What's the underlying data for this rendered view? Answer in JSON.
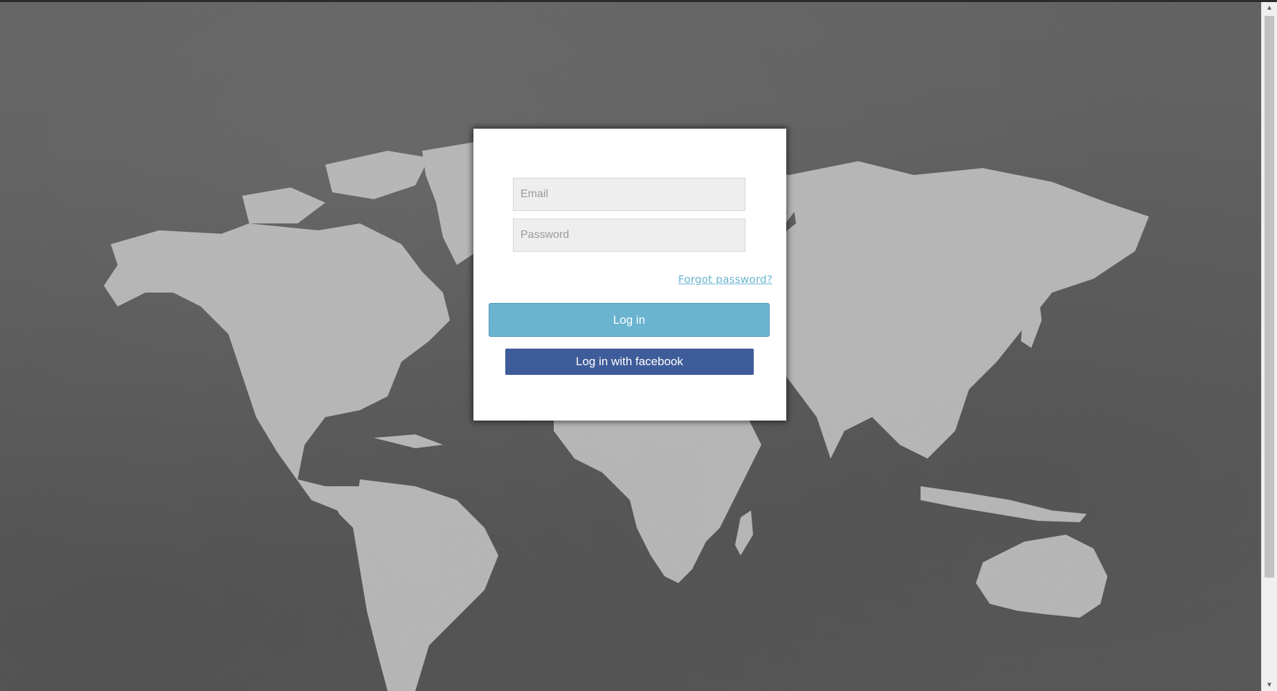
{
  "background": {
    "description_icon": "world-map-background",
    "base_color": "#555555",
    "land_color": "#e4e4e4"
  },
  "login": {
    "email_placeholder": "Email",
    "password_placeholder": "Password",
    "forgot_label": "Forgot password?",
    "login_label": "Log in",
    "facebook_label": "Log in with facebook"
  },
  "colors": {
    "login_button": "#6bb4d0",
    "facebook_button": "#3f5c9a",
    "link": "#6bb6d1"
  },
  "scrollbar": {
    "up_icon": "arrow-up-icon",
    "down_icon": "arrow-down-icon"
  }
}
